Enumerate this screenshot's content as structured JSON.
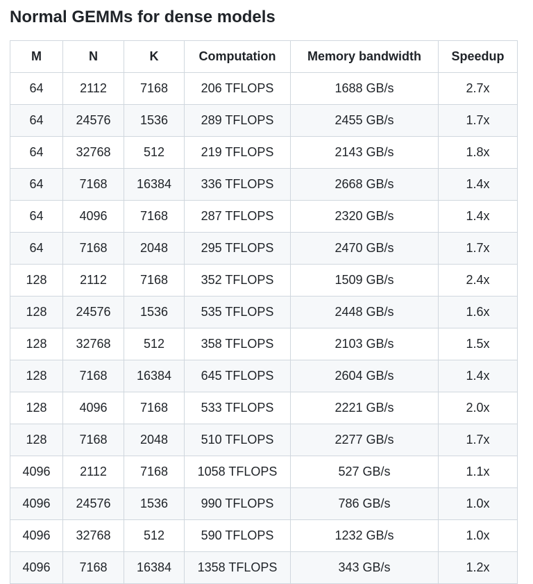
{
  "title": "Normal GEMMs for dense models",
  "table": {
    "headers": [
      "M",
      "N",
      "K",
      "Computation",
      "Memory bandwidth",
      "Speedup"
    ],
    "rows": [
      [
        "64",
        "2112",
        "7168",
        "206 TFLOPS",
        "1688 GB/s",
        "2.7x"
      ],
      [
        "64",
        "24576",
        "1536",
        "289 TFLOPS",
        "2455 GB/s",
        "1.7x"
      ],
      [
        "64",
        "32768",
        "512",
        "219 TFLOPS",
        "2143 GB/s",
        "1.8x"
      ],
      [
        "64",
        "7168",
        "16384",
        "336 TFLOPS",
        "2668 GB/s",
        "1.4x"
      ],
      [
        "64",
        "4096",
        "7168",
        "287 TFLOPS",
        "2320 GB/s",
        "1.4x"
      ],
      [
        "64",
        "7168",
        "2048",
        "295 TFLOPS",
        "2470 GB/s",
        "1.7x"
      ],
      [
        "128",
        "2112",
        "7168",
        "352 TFLOPS",
        "1509 GB/s",
        "2.4x"
      ],
      [
        "128",
        "24576",
        "1536",
        "535 TFLOPS",
        "2448 GB/s",
        "1.6x"
      ],
      [
        "128",
        "32768",
        "512",
        "358 TFLOPS",
        "2103 GB/s",
        "1.5x"
      ],
      [
        "128",
        "7168",
        "16384",
        "645 TFLOPS",
        "2604 GB/s",
        "1.4x"
      ],
      [
        "128",
        "4096",
        "7168",
        "533 TFLOPS",
        "2221 GB/s",
        "2.0x"
      ],
      [
        "128",
        "7168",
        "2048",
        "510 TFLOPS",
        "2277 GB/s",
        "1.7x"
      ],
      [
        "4096",
        "2112",
        "7168",
        "1058 TFLOPS",
        "527 GB/s",
        "1.1x"
      ],
      [
        "4096",
        "24576",
        "1536",
        "990 TFLOPS",
        "786 GB/s",
        "1.0x"
      ],
      [
        "4096",
        "32768",
        "512",
        "590 TFLOPS",
        "1232 GB/s",
        "1.0x"
      ],
      [
        "4096",
        "7168",
        "16384",
        "1358 TFLOPS",
        "343 GB/s",
        "1.2x"
      ]
    ]
  }
}
